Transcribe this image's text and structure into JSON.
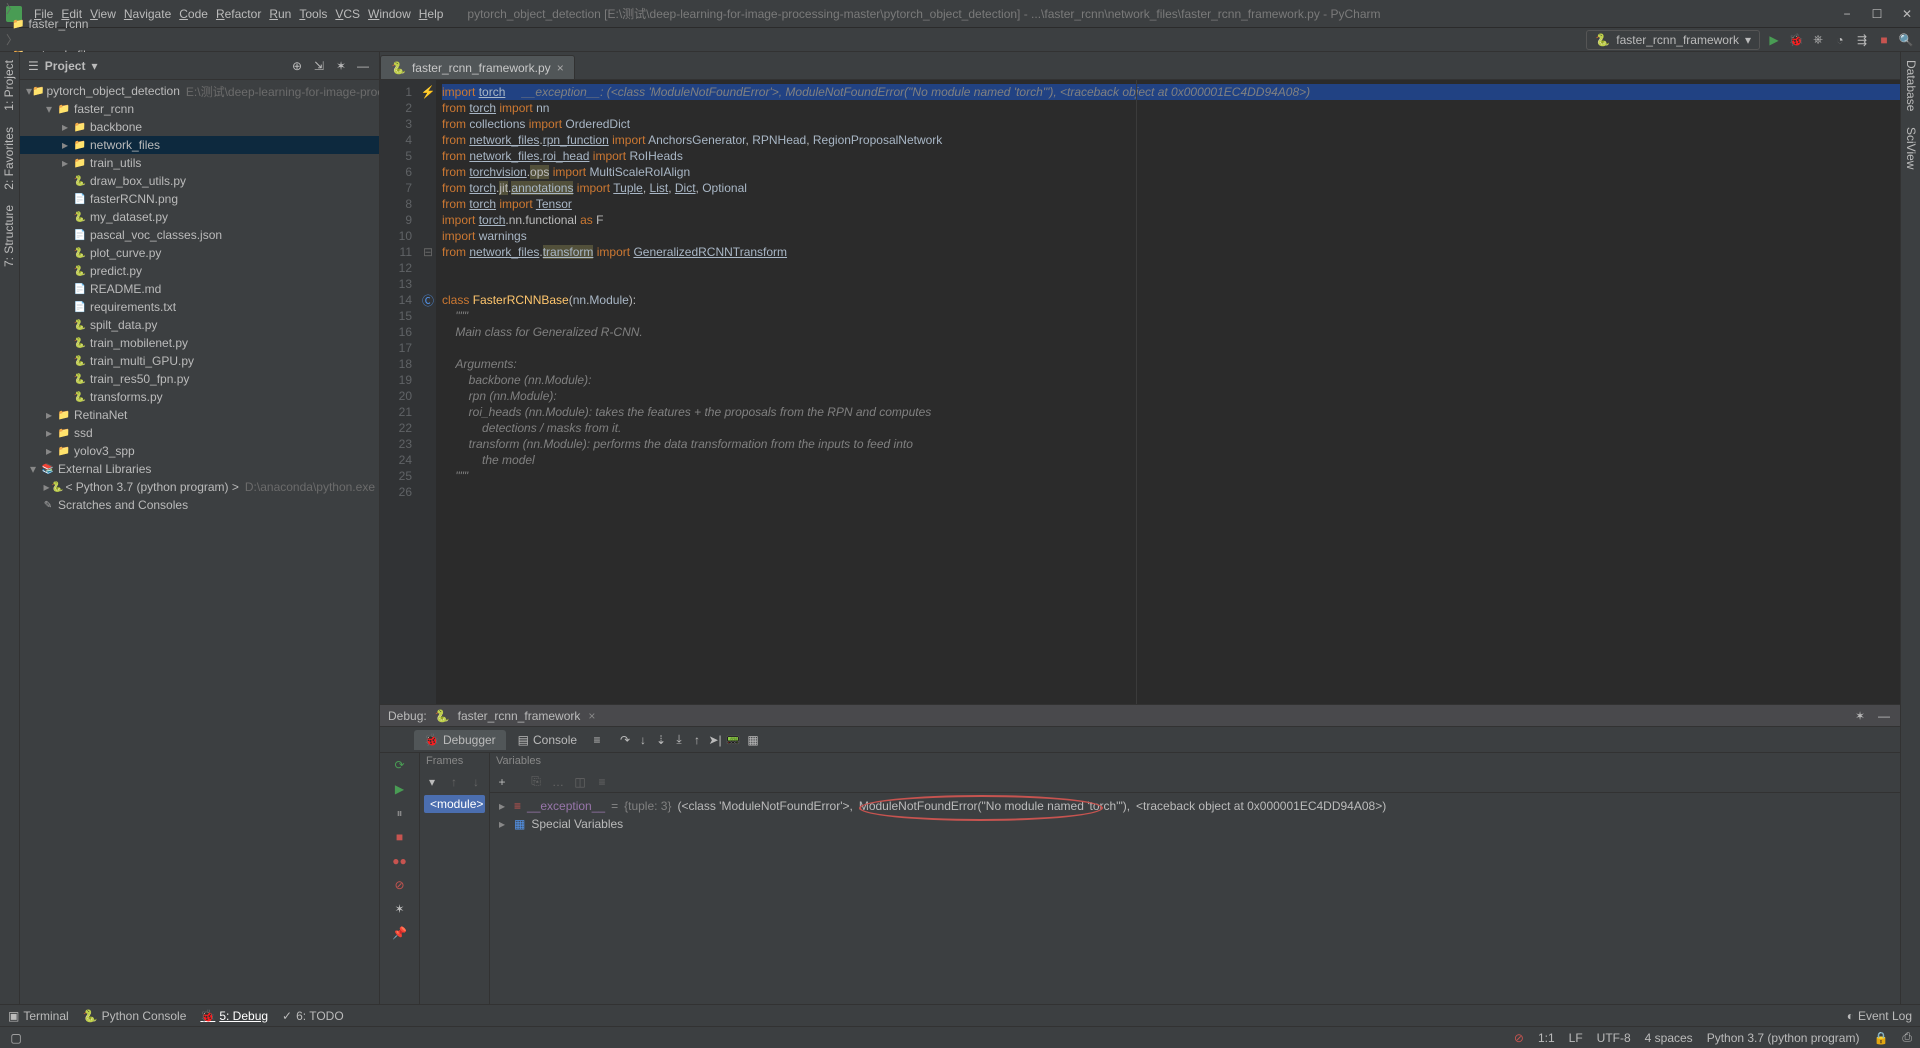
{
  "title": "pytorch_object_detection [E:\\测试\\deep-learning-for-image-processing-master\\pytorch_object_detection] - ...\\faster_rcnn\\network_files\\faster_rcnn_framework.py - PyCharm",
  "menu": [
    "File",
    "Edit",
    "View",
    "Navigate",
    "Code",
    "Refactor",
    "Run",
    "Tools",
    "VCS",
    "Window",
    "Help"
  ],
  "breadcrumbs": [
    "pytorch_object_detection",
    "faster_rcnn",
    "network_files",
    "faster_rcnn_framework.py"
  ],
  "run_config": "faster_rcnn_framework",
  "sidebar": {
    "title": "Project",
    "items": [
      {
        "d": 0,
        "tw": "▾",
        "ic": "folder",
        "label": "pytorch_object_detection",
        "hint": "E:\\测试\\deep-learning-for-image-processing-m..."
      },
      {
        "d": 1,
        "tw": "▾",
        "ic": "folder",
        "label": "faster_rcnn"
      },
      {
        "d": 2,
        "tw": "▸",
        "ic": "folder",
        "label": "backbone"
      },
      {
        "d": 2,
        "tw": "▸",
        "ic": "folder",
        "label": "network_files",
        "sel": true
      },
      {
        "d": 2,
        "tw": "▸",
        "ic": "folder",
        "label": "train_utils"
      },
      {
        "d": 2,
        "tw": "",
        "ic": "py",
        "label": "draw_box_utils.py"
      },
      {
        "d": 2,
        "tw": "",
        "ic": "file",
        "label": "fasterRCNN.png"
      },
      {
        "d": 2,
        "tw": "",
        "ic": "py",
        "label": "my_dataset.py"
      },
      {
        "d": 2,
        "tw": "",
        "ic": "file",
        "label": "pascal_voc_classes.json"
      },
      {
        "d": 2,
        "tw": "",
        "ic": "py",
        "label": "plot_curve.py"
      },
      {
        "d": 2,
        "tw": "",
        "ic": "py",
        "label": "predict.py"
      },
      {
        "d": 2,
        "tw": "",
        "ic": "file",
        "label": "README.md"
      },
      {
        "d": 2,
        "tw": "",
        "ic": "file",
        "label": "requirements.txt"
      },
      {
        "d": 2,
        "tw": "",
        "ic": "py",
        "label": "spilt_data.py"
      },
      {
        "d": 2,
        "tw": "",
        "ic": "py",
        "label": "train_mobilenet.py"
      },
      {
        "d": 2,
        "tw": "",
        "ic": "py",
        "label": "train_multi_GPU.py"
      },
      {
        "d": 2,
        "tw": "",
        "ic": "py",
        "label": "train_res50_fpn.py"
      },
      {
        "d": 2,
        "tw": "",
        "ic": "py",
        "label": "transforms.py"
      },
      {
        "d": 1,
        "tw": "▸",
        "ic": "folder",
        "label": "RetinaNet"
      },
      {
        "d": 1,
        "tw": "▸",
        "ic": "folder",
        "label": "ssd"
      },
      {
        "d": 1,
        "tw": "▸",
        "ic": "folder",
        "label": "yolov3_spp"
      },
      {
        "d": 0,
        "tw": "▾",
        "ic": "lib",
        "label": "External Libraries"
      },
      {
        "d": 1,
        "tw": "▸",
        "ic": "py",
        "label": "< Python 3.7 (python program) >",
        "hint": "D:\\anaconda\\python.exe"
      },
      {
        "d": 0,
        "tw": "",
        "ic": "scratch",
        "label": "Scratches and Consoles"
      }
    ]
  },
  "editor": {
    "tab": "faster_rcnn_framework.py",
    "inline_exception": "__exception__: (<class 'ModuleNotFoundError'>, ModuleNotFoundError(\"No module named 'torch'\"), <traceback object at 0x000001EC4DD94A08>)",
    "lines": [
      {
        "n": 1,
        "mark": "bolt",
        "hl": true,
        "html": "<span class='kw'>import</span> <span class='und'>torch</span>"
      },
      {
        "n": 2,
        "html": "<span class='kw'>from</span> <span class='und'>torch</span> <span class='kw'>import</span> <span class='id'>nn</span>"
      },
      {
        "n": 3,
        "html": "<span class='kw'>from</span> <span class='id'>collections</span> <span class='kw'>import</span> <span class='id'>OrderedDict</span>"
      },
      {
        "n": 4,
        "html": "<span class='kw'>from</span> <span class='und'>network_files</span>.<span class='und wavy'>rpn_function</span> <span class='kw'>import</span> <span class='id'>AnchorsGenerator</span>, <span class='id'>RPNHead</span>, <span class='id'>RegionProposalNetwork</span>"
      },
      {
        "n": 5,
        "html": "<span class='kw'>from</span> <span class='und'>network_files</span>.<span class='und wavy'>roi_head</span> <span class='kw'>import</span> <span class='id'>RoIHeads</span>"
      },
      {
        "n": 6,
        "html": "<span class='kw'>from</span> <span class='und'>torchvision</span>.<span class='warn-bg'>ops</span> <span class='kw'>import</span> <span class='id'>MultiScaleRoIAlign</span>"
      },
      {
        "n": 7,
        "html": "<span class='kw'>from</span> <span class='und'>torch</span>.<span class='warn-bg'>jit</span>.<span class='warn-bg und'>annotations</span> <span class='kw'>import</span> <span class='und'>Tuple</span>, <span class='und'>List</span>, <span class='und'>Dict</span>, <span class='id'>Optional</span>"
      },
      {
        "n": 8,
        "html": "<span class='kw'>from</span> <span class='und'>torch</span> <span class='kw'>import</span> <span class='und'>Tensor</span>"
      },
      {
        "n": 9,
        "html": "<span class='kw'>import</span> <span class='und'>torch</span>.nn.functional <span class='kw'>as</span> F"
      },
      {
        "n": 10,
        "html": "<span class='kw'>import</span> <span class='id'>warnings</span>"
      },
      {
        "n": 11,
        "mark": "endg",
        "html": "<span class='kw'>from</span> <span class='und'>network_files</span>.<span class='warn-bg und'>transform</span> <span class='kw'>import</span> <span class='und wavy'>GeneralizedRCNNTransform</span>"
      },
      {
        "n": 12,
        "html": ""
      },
      {
        "n": 13,
        "html": ""
      },
      {
        "n": 14,
        "mark": "cls",
        "html": "<span class='kw'>class</span> <span class='fn'>FasterRCNNBase</span>(<span class='id'>nn</span>.<span class='id'>Module</span>):"
      },
      {
        "n": 15,
        "html": "    <span class='cmt'>\"\"\"</span>"
      },
      {
        "n": 16,
        "html": "    <span class='cmt'>Main class for Generalized R-CNN.</span>"
      },
      {
        "n": 17,
        "html": ""
      },
      {
        "n": 18,
        "html": "    <span class='cmt'>Arguments:</span>"
      },
      {
        "n": 19,
        "html": "        <span class='cmt'>backbone (nn.Module):</span>"
      },
      {
        "n": 20,
        "html": "        <span class='cmt'>rpn (nn.Module):</span>"
      },
      {
        "n": 21,
        "html": "        <span class='cmt'>roi_heads (nn.Module): takes the features + the proposals from the RPN and computes</span>"
      },
      {
        "n": 22,
        "html": "            <span class='cmt'>detections / masks from it.</span>"
      },
      {
        "n": 23,
        "html": "        <span class='cmt'>transform (nn.Module): performs the data transformation from the inputs to feed into</span>"
      },
      {
        "n": 24,
        "html": "            <span class='cmt'>the model</span>"
      },
      {
        "n": 25,
        "html": "    <span class='cmt'>\"\"\"</span>"
      },
      {
        "n": 26,
        "html": ""
      }
    ]
  },
  "debug": {
    "title": "Debug:",
    "session": "faster_rcnn_framework",
    "tabs": {
      "debugger": "Debugger",
      "console": "Console"
    },
    "frames_title": "Frames",
    "vars_title": "Variables",
    "frame": "<module>",
    "var_exc_name": "__exception__",
    "var_exc_type": "{tuple: 3}",
    "var_exc_pre": "(<class 'ModuleNotFoundError'>,",
    "var_exc_mid": "ModuleNotFoundError(\"No module named 'torch'\"),",
    "var_exc_post": "<traceback object at 0x000001EC4DD94A08>)",
    "special": "Special Variables"
  },
  "toolwindows": {
    "terminal": "Terminal",
    "pyconsole": "Python Console",
    "debug": "5: Debug",
    "todo": "6: TODO",
    "eventlog": "Event Log"
  },
  "status": {
    "pos": "1:1",
    "le": "LF",
    "enc": "UTF-8",
    "indent": "4 spaces",
    "py": "Python 3.7 (python program)"
  },
  "left_gutter": [
    "1: Project",
    "2: Favorites",
    "7: Structure"
  ],
  "right_gutter": [
    "Database",
    "SciView"
  ]
}
